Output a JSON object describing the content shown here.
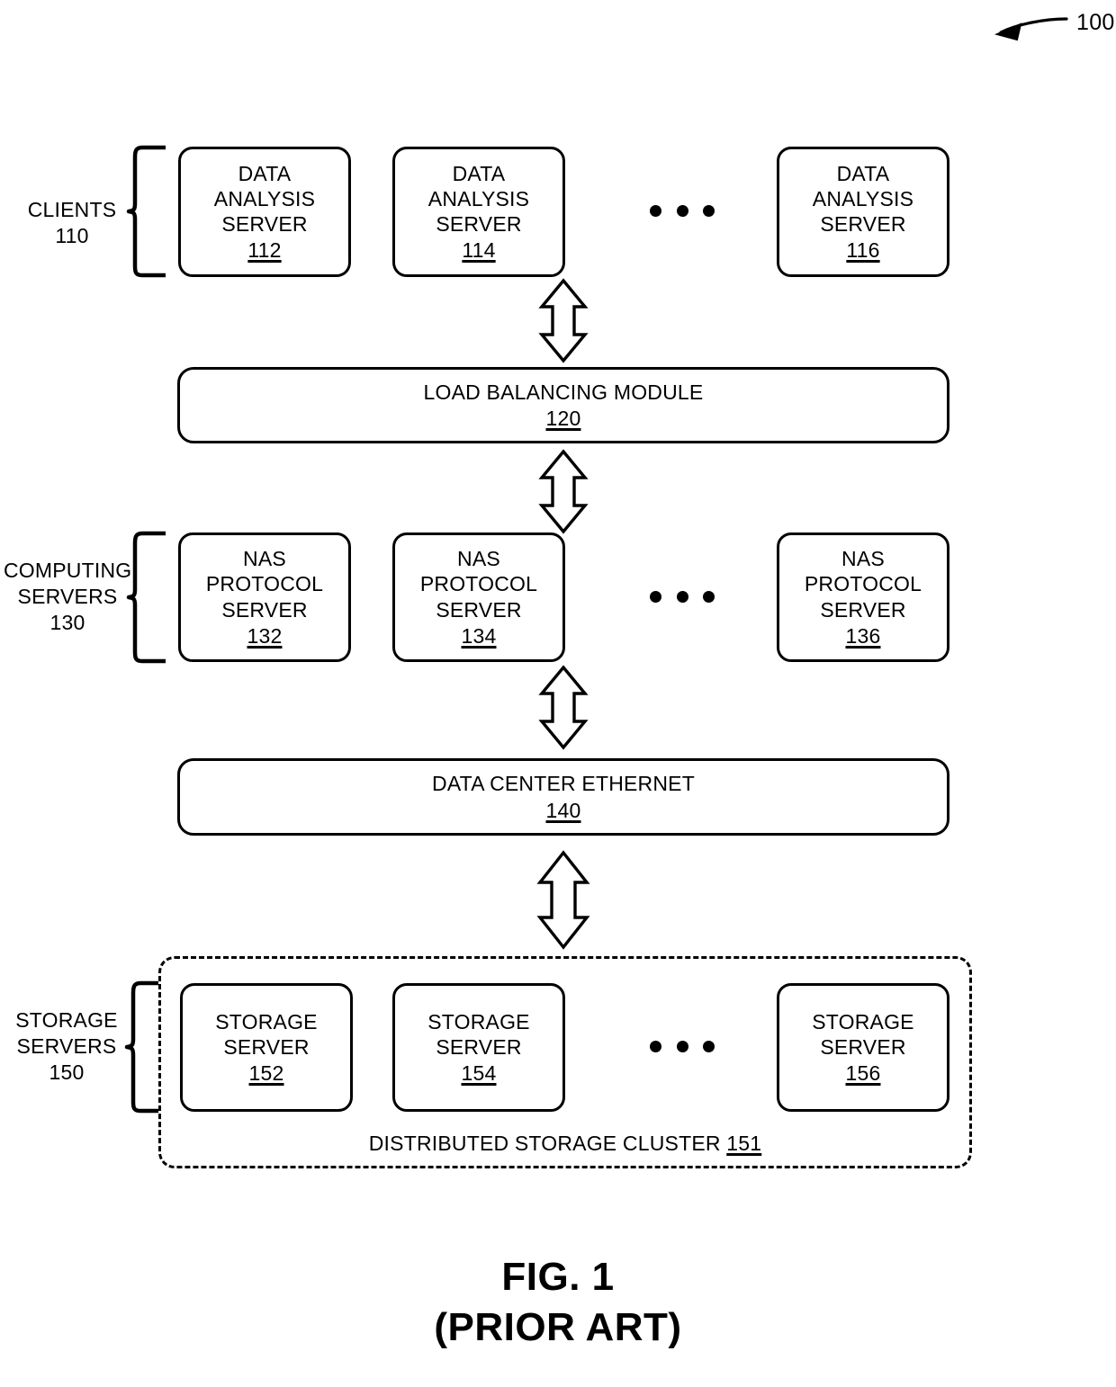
{
  "figure": {
    "callout_number": "100",
    "caption_line1": "FIG. 1",
    "caption_line2": "(PRIOR ART)"
  },
  "groups": {
    "clients": {
      "name": "CLIENTS",
      "ref": "110"
    },
    "computing_servers": {
      "name_line1": "COMPUTING",
      "name_line2": "SERVERS",
      "ref": "130"
    },
    "storage_servers": {
      "name_line1": "STORAGE",
      "name_line2": "SERVERS",
      "ref": "150"
    }
  },
  "rows": {
    "clients": [
      {
        "line1": "DATA",
        "line2": "ANALYSIS",
        "line3": "SERVER",
        "ref": "112"
      },
      {
        "line1": "DATA",
        "line2": "ANALYSIS",
        "line3": "SERVER",
        "ref": "114"
      },
      {
        "line1": "DATA",
        "line2": "ANALYSIS",
        "line3": "SERVER",
        "ref": "116"
      }
    ],
    "computing": [
      {
        "line1": "NAS",
        "line2": "PROTOCOL",
        "line3": "SERVER",
        "ref": "132"
      },
      {
        "line1": "NAS",
        "line2": "PROTOCOL",
        "line3": "SERVER",
        "ref": "134"
      },
      {
        "line1": "NAS",
        "line2": "PROTOCOL",
        "line3": "SERVER",
        "ref": "136"
      }
    ],
    "storage": [
      {
        "line1": "STORAGE",
        "line2": "SERVER",
        "ref": "152"
      },
      {
        "line1": "STORAGE",
        "line2": "SERVER",
        "ref": "154"
      },
      {
        "line1": "STORAGE",
        "line2": "SERVER",
        "ref": "156"
      }
    ]
  },
  "bars": {
    "load_balancing": {
      "title": "LOAD BALANCING MODULE",
      "ref": "120"
    },
    "data_center_ethernet": {
      "title": "DATA CENTER ETHERNET",
      "ref": "140"
    }
  },
  "cluster": {
    "label": "DISTRIBUTED STORAGE CLUSTER",
    "ref": "151"
  },
  "icons": {
    "ellipsis": "ellipsis-dots-icon",
    "arrow": "double-headed-vertical-arrow-icon",
    "brace": "curly-brace-icon",
    "callout": "callout-leader-arrow-icon"
  },
  "colors": {
    "stroke": "#000000",
    "background": "#ffffff"
  }
}
